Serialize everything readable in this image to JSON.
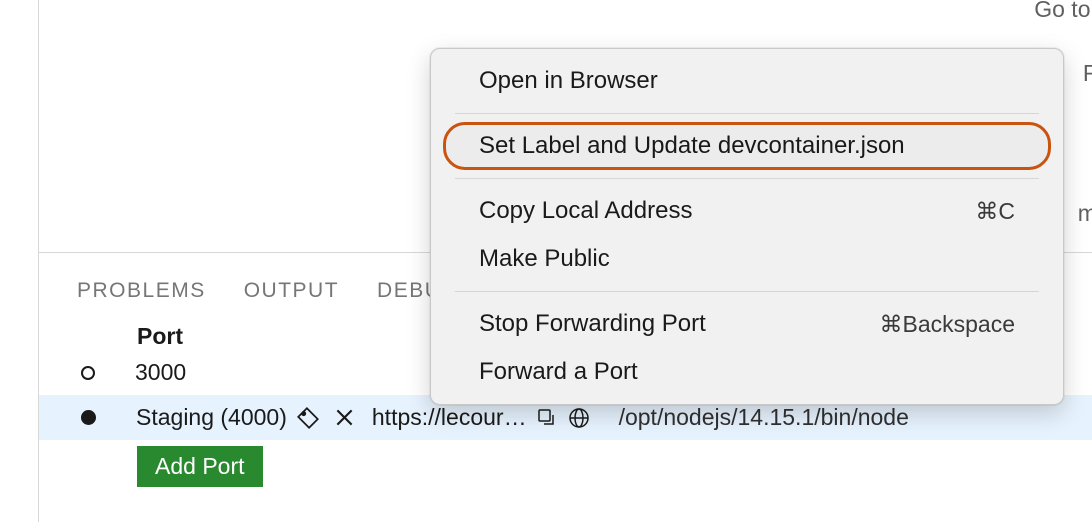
{
  "fragments": {
    "f1": "Go to l",
    "f2": "Fi",
    "f3": "mi"
  },
  "panel": {
    "tabs": [
      "PROBLEMS",
      "OUTPUT",
      "DEBU"
    ],
    "port_header": "Port",
    "rows": [
      {
        "label": "3000"
      },
      {
        "label": "Staging (4000)",
        "forwarded": "https://lecour…",
        "process": "/opt/nodejs/14.15.1/bin/node"
      }
    ],
    "add_port": "Add Port"
  },
  "menu": {
    "items": [
      {
        "label": "Open in Browser",
        "shortcut": ""
      },
      {
        "label": "Set Label and Update devcontainer.json",
        "shortcut": "",
        "highlighted": true
      },
      {
        "label": "Copy Local Address",
        "shortcut": "⌘C"
      },
      {
        "label": "Make Public",
        "shortcut": ""
      },
      {
        "label": "Stop Forwarding Port",
        "shortcut": "⌘Backspace"
      },
      {
        "label": "Forward a Port",
        "shortcut": ""
      }
    ]
  }
}
